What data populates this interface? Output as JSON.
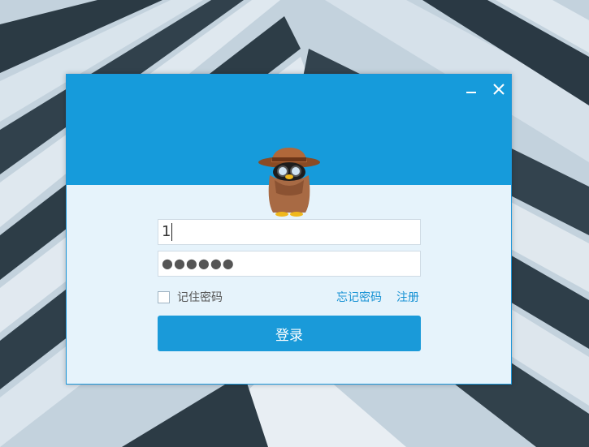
{
  "login": {
    "username_value": "1",
    "password_masked": "●●●●●●",
    "remember_label": "记住密码",
    "remember_checked": false,
    "forgot_label": "忘记密码",
    "register_label": "注册",
    "login_label": "登录"
  },
  "icons": {
    "minimize": "minimize-icon",
    "close": "close-icon",
    "avatar": "penguin-detective-avatar"
  },
  "colors": {
    "header": "#169bdb",
    "panel": "#e6f3fb",
    "button": "#1a9ad9",
    "link": "#1792d4"
  }
}
